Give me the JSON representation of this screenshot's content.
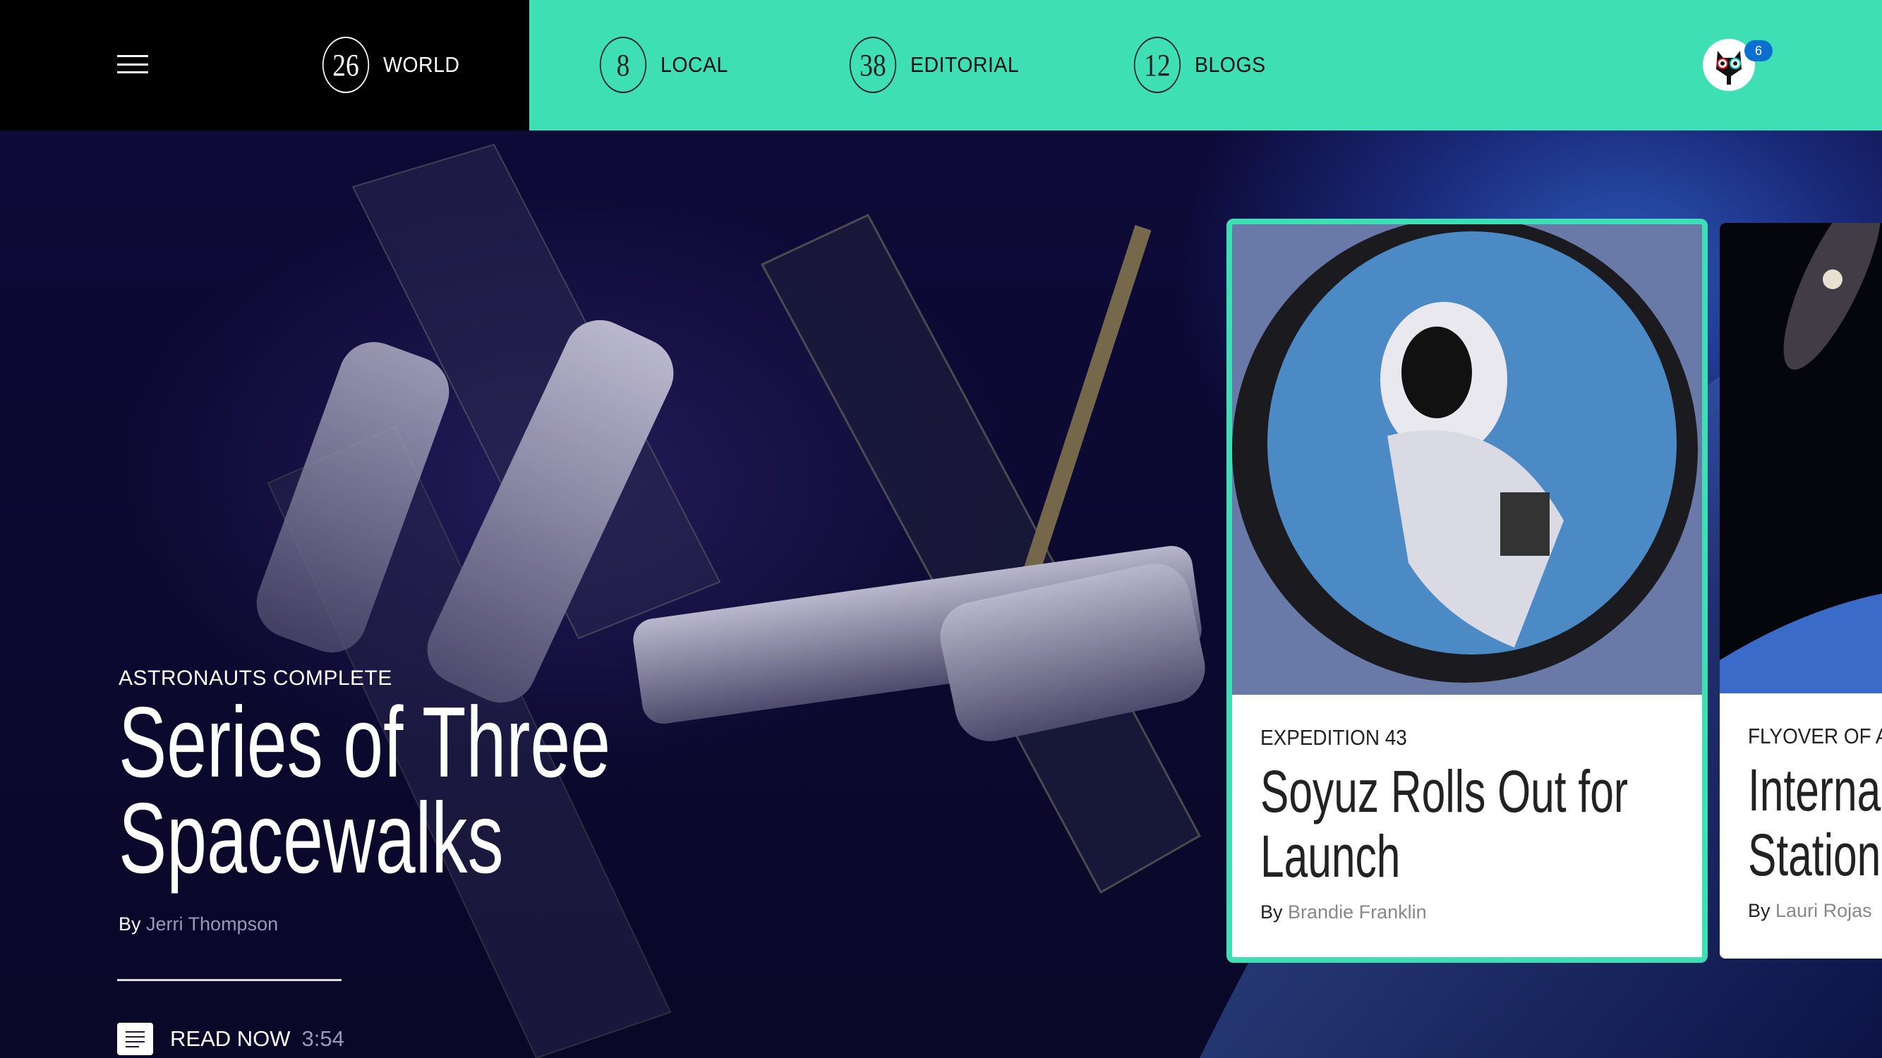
{
  "nav": {
    "menu_icon": "hamburger-icon",
    "items": [
      {
        "count": "26",
        "label": "WORLD",
        "active": true
      },
      {
        "count": "8",
        "label": "LOCAL"
      },
      {
        "count": "38",
        "label": "EDITORIAL"
      },
      {
        "count": "12",
        "label": "BLOGS"
      }
    ],
    "notification_count": "6",
    "colors": {
      "accent": "#3fdfb6",
      "active_bg": "#000000",
      "badge": "#0b6fd0"
    }
  },
  "hero": {
    "kicker": "ASTRONAUTS COMPLETE",
    "title_line1": "Series of Three",
    "title_line2": "Spacewalks",
    "by": "By",
    "author": "Jerri Thompson",
    "read_label": "READ NOW",
    "read_time": "3:54",
    "read_icon": "document-icon"
  },
  "cards": [
    {
      "kicker": "EXPEDITION 43",
      "title_line1": "Soyuz Rolls Out for",
      "title_line2": "Launch",
      "by": "By",
      "author": "Brandie Franklin",
      "selected": true
    },
    {
      "kicker": "FLYOVER OF A",
      "title_line1": "Interna",
      "title_line2": "Station",
      "by": "By",
      "author": "Lauri Rojas"
    }
  ]
}
